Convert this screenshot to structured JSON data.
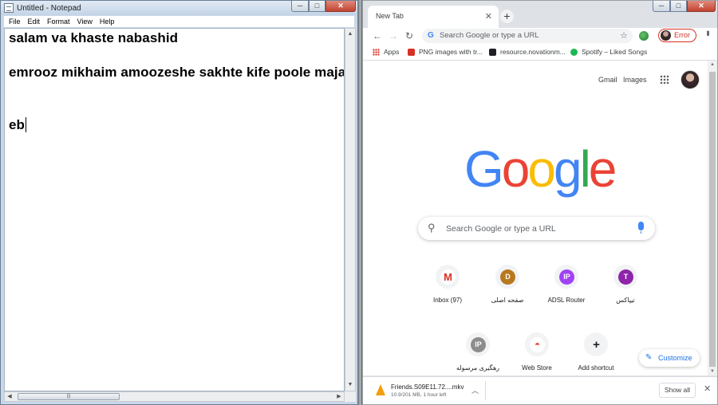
{
  "notepad": {
    "title": "Untitled - Notepad",
    "menu": [
      "File",
      "Edit",
      "Format",
      "View",
      "Help"
    ],
    "lines": [
      "salam va khaste nabashid",
      "emrooz mikhaim amoozeshe sakhte kife poole majazio b",
      "eb"
    ],
    "caption": {
      "minimize": "─",
      "maximize": "□",
      "close": "✕"
    }
  },
  "chrome": {
    "tab_title": "New Tab",
    "tab_close": "✕",
    "new_tab": "+",
    "omnibox_placeholder": "Search Google or type a URL",
    "profile_status": "Error",
    "bookmarks": [
      {
        "label": "Apps",
        "icon": "apps-grid-icon",
        "color": "#5f6368"
      },
      {
        "label": "PNG images with tr...",
        "icon": "png-favicon",
        "color": "#d93025"
      },
      {
        "label": "resource.novationm...",
        "icon": "novation-favicon",
        "color": "#202124"
      },
      {
        "label": "Spotify – Liked Songs",
        "icon": "spotify-icon",
        "color": "#1db954"
      }
    ],
    "page": {
      "gmail_link": "Gmail",
      "images_link": "Images",
      "search_placeholder": "Search Google or type a URL",
      "logo_letters": [
        {
          "ch": "G",
          "color": "#4285f4"
        },
        {
          "ch": "o",
          "color": "#ea4335"
        },
        {
          "ch": "o",
          "color": "#fbbc05"
        },
        {
          "ch": "g",
          "color": "#4285f4"
        },
        {
          "ch": "l",
          "color": "#34a853"
        },
        {
          "ch": "e",
          "color": "#ea4335"
        }
      ],
      "shortcuts": [
        {
          "label": "Inbox (97)",
          "badge": "M",
          "color": "#ffffff",
          "text_color": "#d93025"
        },
        {
          "label": "صفحه اصلی",
          "badge": "D",
          "color": "#b7791f",
          "text_color": "#ffffff"
        },
        {
          "label": "ADSL Router",
          "badge": "IP",
          "color": "#a142f4",
          "text_color": "#ffffff"
        },
        {
          "label": "تیپاکس",
          "badge": "T",
          "color": "#8e24aa",
          "text_color": "#ffffff"
        },
        {
          "label": "رهگیری مرسوله",
          "badge": "IP",
          "color": "#8d8d8d",
          "text_color": "#ffffff"
        },
        {
          "label": "Web Store",
          "badge": "◓",
          "color": "#ffffff",
          "text_color": "#ea4335"
        },
        {
          "label": "Add shortcut",
          "badge": "+",
          "color": "#f1f3f4",
          "text_color": "#202124"
        }
      ],
      "customize_label": "Customize"
    },
    "download": {
      "filename": "Friends.S09E11.72....mkv",
      "status": "10.9/201 MB, 1 hour left",
      "show_all": "Show all"
    }
  }
}
